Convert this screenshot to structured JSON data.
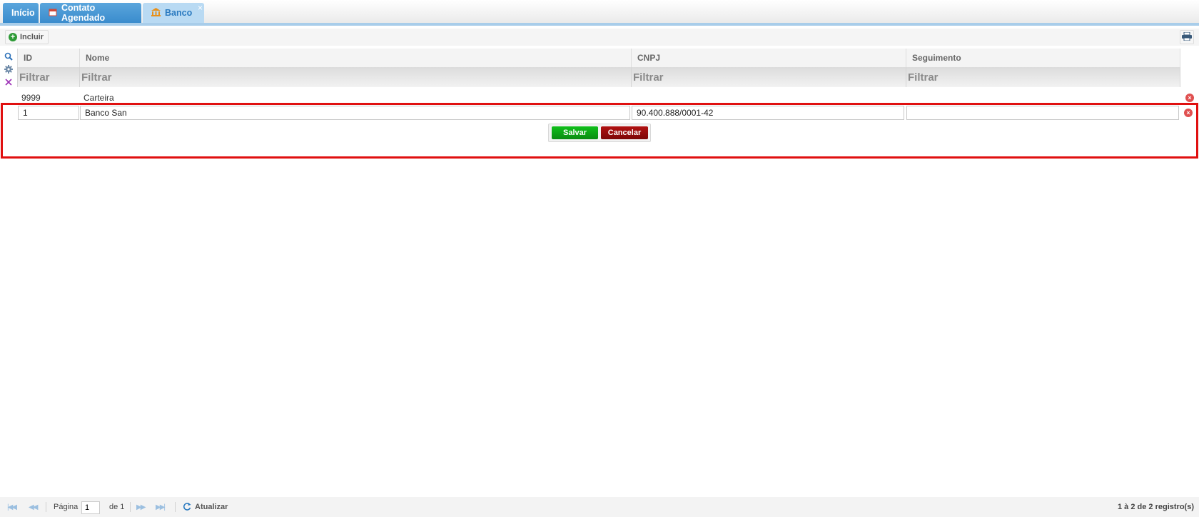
{
  "tabs": [
    {
      "label": "Início"
    },
    {
      "label": "Contato Agendado"
    },
    {
      "label": "Banco",
      "close": "×"
    }
  ],
  "toolbar": {
    "include_label": "Incluir"
  },
  "grid": {
    "columns": [
      "ID",
      "Nome",
      "CNPJ",
      "Seguimento"
    ],
    "filter_placeholder": "Filtrar",
    "rows": [
      {
        "id": "9999",
        "nome": "Carteira",
        "cnpj": "",
        "seguimento": ""
      }
    ]
  },
  "edit_row": {
    "id": "1",
    "nome": "Banco San",
    "cnpj": "90.400.888/0001-42",
    "seguimento": "",
    "save_label": "Salvar",
    "cancel_label": "Cancelar"
  },
  "footer": {
    "page_label": "Página",
    "page_value": "1",
    "of_label": "de 1",
    "refresh_label": "Atualizar",
    "records_text": "1 à 2 de 2 registro(s)"
  }
}
